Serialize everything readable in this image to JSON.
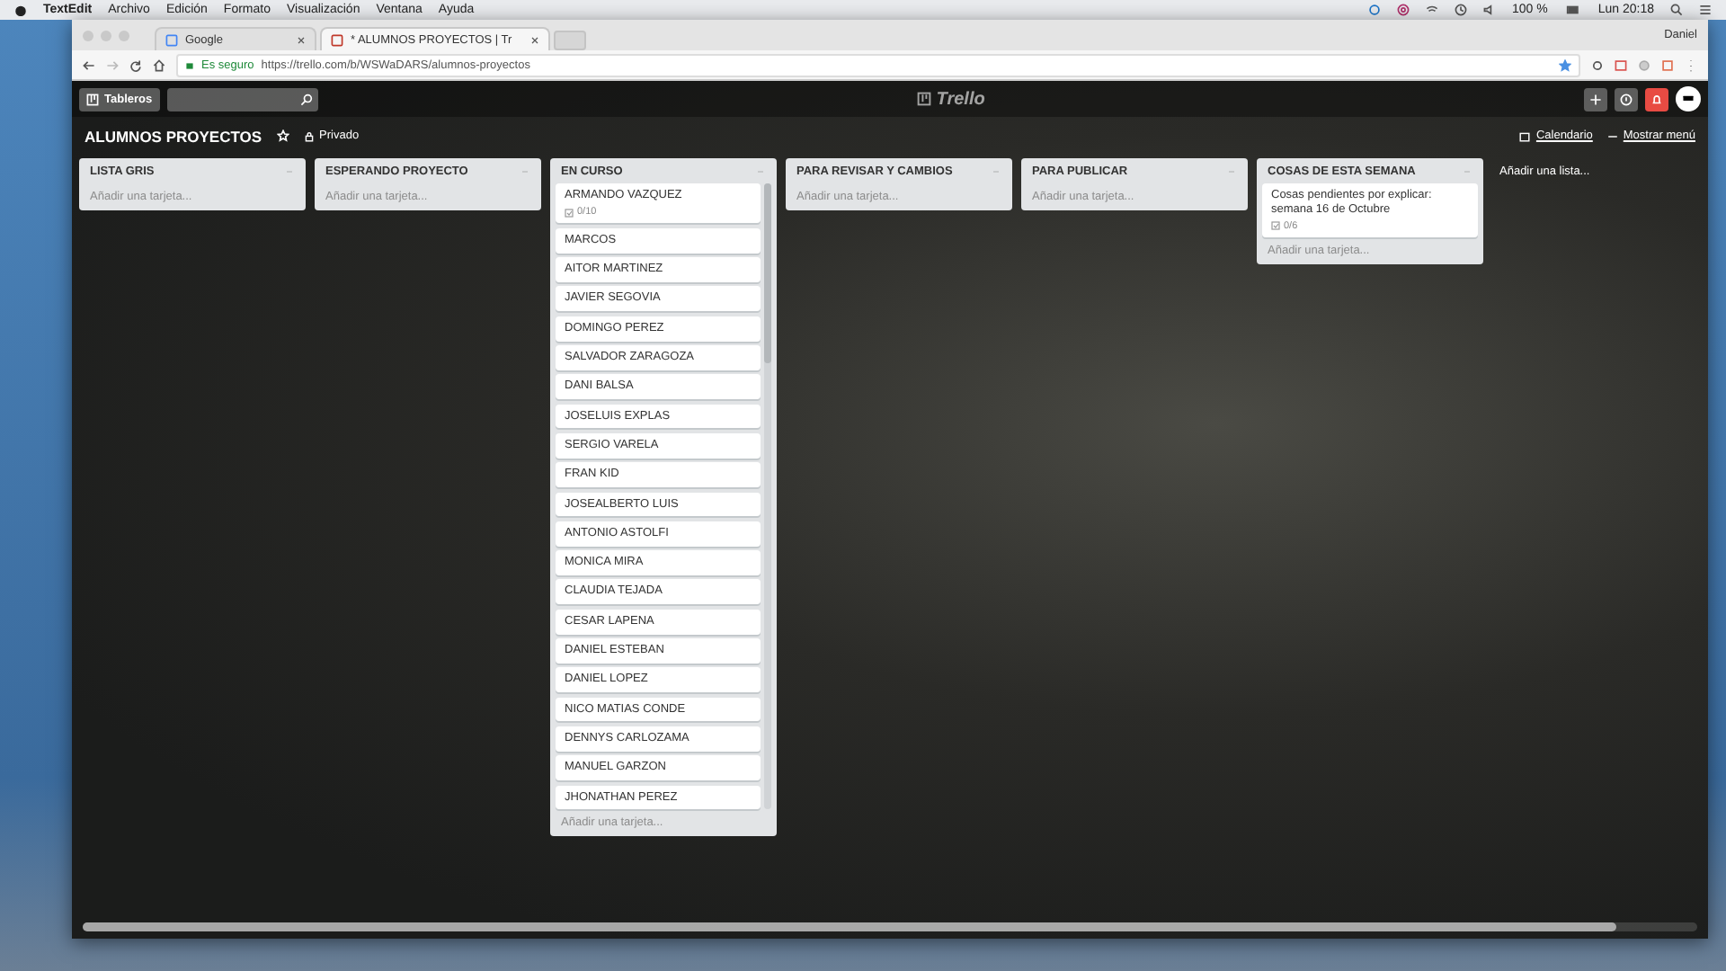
{
  "menu_bar": {
    "app": "TextEdit",
    "items": [
      "Archivo",
      "Edición",
      "Formato",
      "Visualización",
      "Ventana",
      "Ayuda"
    ],
    "battery": "100 %",
    "clock": "Lun 20:18"
  },
  "browser": {
    "tabs": [
      {
        "label": "Google",
        "selected": false
      },
      {
        "label": "* ALUMNOS PROYECTOS | Tr",
        "selected": true
      }
    ],
    "profile": "Daniel",
    "security": "Es seguro",
    "url": "https://trello.com/b/WSWaDARS/alumnos-proyectos"
  },
  "trello_header": {
    "boards_button": "Tableros",
    "logo": "Trello"
  },
  "board": {
    "title": "ALUMNOS PROYECTOS",
    "visibility": "Privado",
    "calendar": "Calendario",
    "menu": "Mostrar menú"
  },
  "lists": [
    {
      "title": "LISTA GRIS",
      "add_card": "Añadir una tarjeta..."
    },
    {
      "title": "ESPERANDO PROYECTO",
      "add_card": "Añadir una tarjeta..."
    },
    {
      "title": "EN CURSO",
      "cards": [
        {
          "title": "ARMANDO VAZQUEZ",
          "checklist": "0/10"
        },
        {
          "title": "MARCOS"
        },
        {
          "title": "AITOR MARTINEZ"
        },
        {
          "title": "JAVIER SEGOVIA"
        },
        {
          "title": "DOMINGO PEREZ"
        },
        {
          "title": "SALVADOR ZARAGOZA"
        },
        {
          "title": "DANI BALSA"
        },
        {
          "title": "JOSELUIS EXPLAS"
        },
        {
          "title": "SERGIO VARELA"
        },
        {
          "title": "FRAN KID"
        },
        {
          "title": "JOSEALBERTO LUIS"
        },
        {
          "title": "ANTONIO ASTOLFI"
        },
        {
          "title": "MONICA MIRA"
        },
        {
          "title": "CLAUDIA TEJADA"
        },
        {
          "title": "CESAR LAPENA"
        },
        {
          "title": "DANIEL ESTEBAN"
        },
        {
          "title": "DANIEL LOPEZ"
        },
        {
          "title": "NICO MATIAS CONDE"
        },
        {
          "title": "DENNYS CARLOZAMA"
        },
        {
          "title": "MANUEL GARZON"
        },
        {
          "title": "JHONATHAN PEREZ"
        }
      ],
      "add_card": "Añadir una tarjeta..."
    },
    {
      "title": "PARA REVISAR Y CAMBIOS",
      "add_card": "Añadir una tarjeta..."
    },
    {
      "title": "PARA PUBLICAR",
      "add_card": "Añadir una tarjeta..."
    },
    {
      "title": "COSAS DE ESTA SEMANA",
      "cards": [
        {
          "title": "Cosas pendientes por explicar: semana 16 de Octubre",
          "checklist": "0/6"
        }
      ],
      "add_card": "Añadir una tarjeta..."
    }
  ],
  "add_list": "Añadir una lista..."
}
